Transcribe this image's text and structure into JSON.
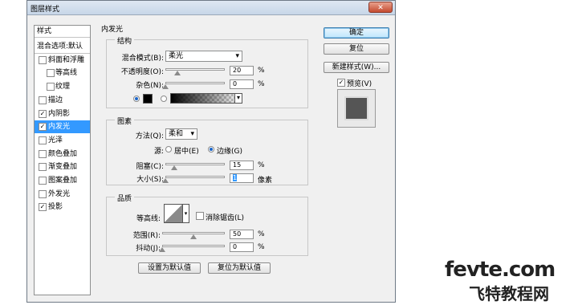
{
  "window": {
    "title": "图层样式",
    "close_glyph": "✕"
  },
  "styles_panel": {
    "header": "样式",
    "items": [
      {
        "label": "混合选项:默认",
        "checkbox": false,
        "checked": false
      },
      {
        "label": "斜面和浮雕",
        "checkbox": true,
        "checked": false
      },
      {
        "label": "等高线",
        "checkbox": true,
        "checked": false,
        "sub": true
      },
      {
        "label": "纹理",
        "checkbox": true,
        "checked": false,
        "sub": true
      },
      {
        "label": "描边",
        "checkbox": true,
        "checked": false
      },
      {
        "label": "内阴影",
        "checkbox": true,
        "checked": true
      },
      {
        "label": "内发光",
        "checkbox": true,
        "checked": true,
        "selected": true
      },
      {
        "label": "光泽",
        "checkbox": true,
        "checked": false
      },
      {
        "label": "颜色叠加",
        "checkbox": true,
        "checked": false
      },
      {
        "label": "渐变叠加",
        "checkbox": true,
        "checked": false
      },
      {
        "label": "图案叠加",
        "checkbox": true,
        "checked": false
      },
      {
        "label": "外发光",
        "checkbox": true,
        "checked": false
      },
      {
        "label": "投影",
        "checkbox": true,
        "checked": true
      }
    ]
  },
  "inner_glow": {
    "section_title": "内发光",
    "structure": {
      "title": "结构",
      "blend_mode_label": "混合模式(B):",
      "blend_mode_value": "柔光",
      "opacity_label": "不透明度(O):",
      "opacity_value": "20",
      "opacity_fraction": 0.2,
      "noise_label": "杂色(N):",
      "noise_value": "0",
      "noise_fraction": 0,
      "percent": "%",
      "color": "#000000"
    },
    "elements": {
      "title": "图素",
      "method_label": "方法(Q):",
      "method_value": "柔和",
      "source_label": "源:",
      "source_center": "居中(E)",
      "source_edge": "边缘(G)",
      "choke_label": "阻塞(C):",
      "choke_value": "15",
      "choke_fraction": 0.15,
      "size_label": "大小(S):",
      "size_value": "1",
      "size_unit": "像素",
      "percent": "%"
    },
    "quality": {
      "title": "品质",
      "contour_label": "等高线:",
      "antialias_label": "消除锯齿(L)",
      "range_label": "范围(R):",
      "range_value": "50",
      "range_fraction": 0.5,
      "jitter_label": "抖动(J):",
      "jitter_value": "0",
      "jitter_fraction": 0,
      "percent": "%"
    },
    "set_default": "设置为默认值",
    "reset_default": "复位为默认值"
  },
  "buttons": {
    "ok": "确定",
    "reset": "复位",
    "new_style": "新建样式(W)...",
    "preview_label": "预览(V)",
    "preview_checked": true
  },
  "watermark": {
    "line1": "fevte.com",
    "line2": "飞特教程网"
  },
  "colors": {
    "selection": "#3399ff",
    "accent": "#1b66c9"
  }
}
